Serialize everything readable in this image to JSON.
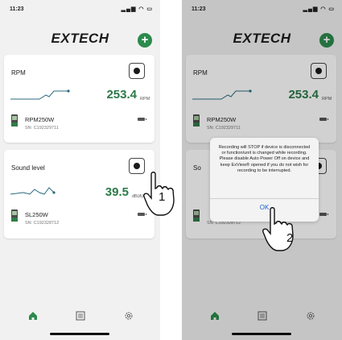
{
  "screens": [
    {
      "status_time": "11:23",
      "brand": "EXTECH",
      "cards": [
        {
          "title": "RPM",
          "reading": "253.4",
          "unit": "RPM",
          "device_name": "RPM250W",
          "device_sn": "SN: C192329711"
        },
        {
          "title": "Sound level",
          "reading": "39.5",
          "unit": "dB(A)",
          "device_name": "SL250W",
          "device_sn": "SN: C192328712"
        }
      ],
      "callout": "1"
    },
    {
      "status_time": "11:23",
      "brand": "EXTECH",
      "cards": [
        {
          "title": "RPM",
          "reading": "253.4",
          "unit": "RPM",
          "device_name": "RPM250W",
          "device_sn": "SN: C192329711"
        },
        {
          "title": "Sound level",
          "reading": "",
          "unit": "",
          "device_name": "",
          "device_sn": "SN: C192328712"
        }
      ],
      "dialog": {
        "message": "Recording will STOP if device is disconnected or function/unit is changed while recording. Please disable Auto Power Off on device and keep ExView® opened if you do not wish for recording to be interrupted.",
        "ok_label": "OK"
      },
      "callout": "2"
    }
  ],
  "status_icons": "signal-icon wifi-icon battery-icon",
  "colors": {
    "accent": "#2c8a4d",
    "reading": "#2c7a48",
    "link": "#1a5dd0"
  }
}
